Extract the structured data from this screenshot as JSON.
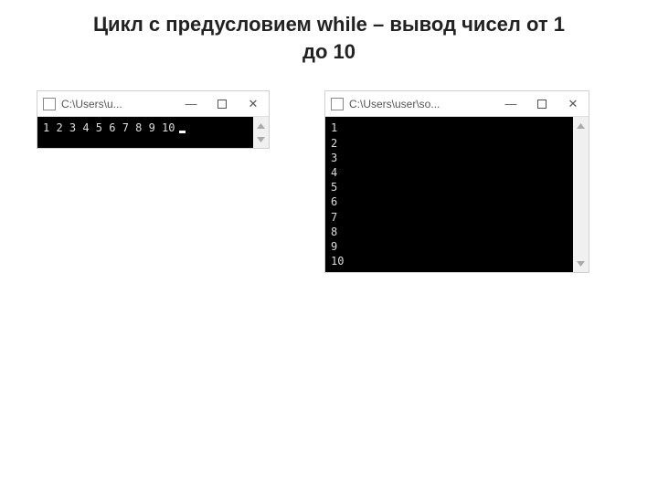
{
  "title_line1": "Цикл с предусловием while – вывод чисел от 1",
  "title_line2": "до 10",
  "windows": {
    "left": {
      "title": "C:\\Users\\u...",
      "output": "1 2 3 4 5 6 7 8 9 10"
    },
    "right": {
      "title": "C:\\Users\\user\\so...",
      "output": "1\n2\n3\n4\n5\n6\n7\n8\n9\n10"
    }
  },
  "controls": {
    "minimize": "—",
    "close": "✕"
  }
}
